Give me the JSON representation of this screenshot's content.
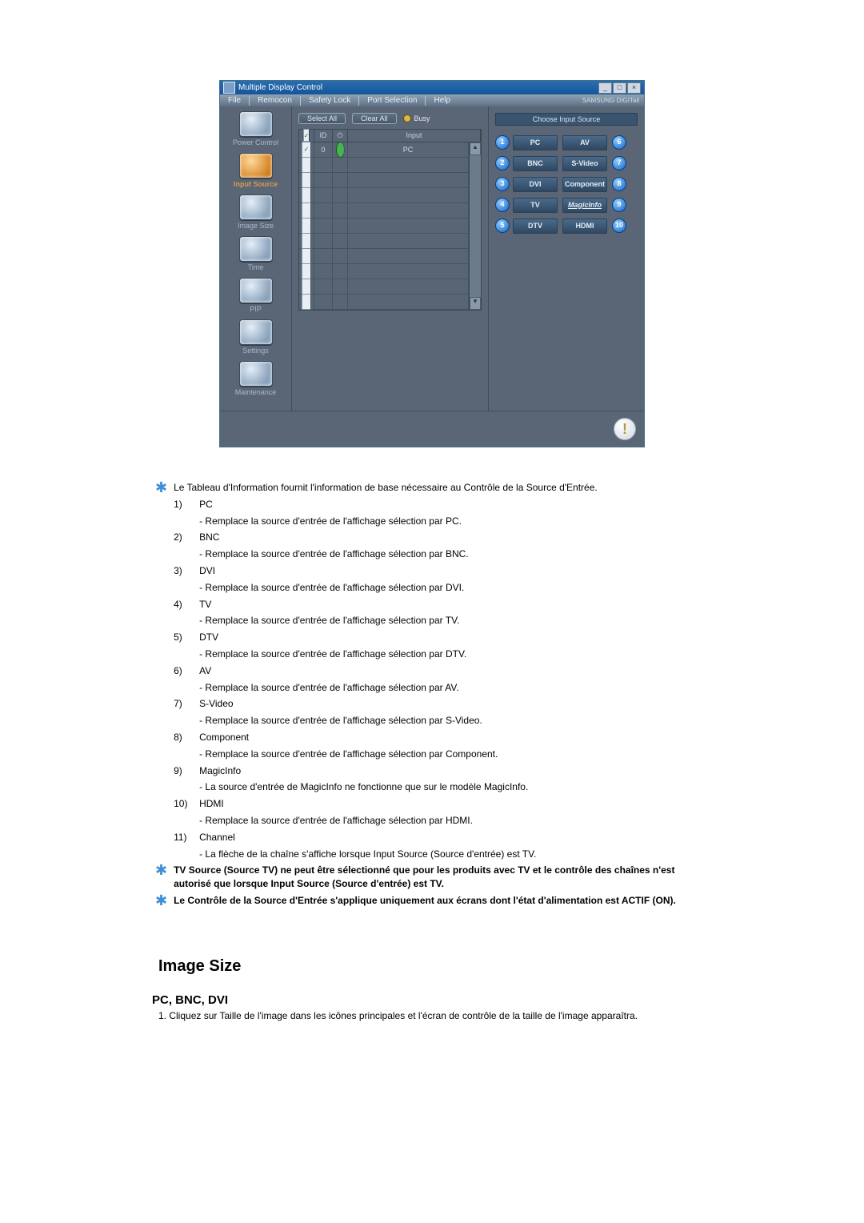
{
  "win": {
    "title": "Multiple Display Control",
    "menu": [
      "File",
      "Remocon",
      "Safety Lock",
      "Port Selection",
      "Help"
    ],
    "brand": "SAMSUNG DIGITall"
  },
  "nav": [
    {
      "label": "Power Control"
    },
    {
      "label": "Input Source"
    },
    {
      "label": "Image Size"
    },
    {
      "label": "Time"
    },
    {
      "label": "PIP"
    },
    {
      "label": "Settings"
    },
    {
      "label": "Maintenance"
    }
  ],
  "toolbar": {
    "selectAll": "Select All",
    "clearAll": "Clear All",
    "busy": "Busy"
  },
  "gridheader": {
    "id": "ID",
    "input": "Input"
  },
  "row0": {
    "id": "0",
    "input": "PC"
  },
  "right": {
    "title": "Choose Input Source",
    "left": [
      {
        "n": "1",
        "t": "PC"
      },
      {
        "n": "2",
        "t": "BNC"
      },
      {
        "n": "3",
        "t": "DVI"
      },
      {
        "n": "4",
        "t": "TV"
      },
      {
        "n": "5",
        "t": "DTV"
      }
    ],
    "rightcol": [
      {
        "n": "6",
        "t": "AV"
      },
      {
        "n": "7",
        "t": "S-Video"
      },
      {
        "n": "8",
        "t": "Component"
      },
      {
        "n": "9",
        "t": "MagicInfo"
      },
      {
        "n": "10",
        "t": "HDMI"
      }
    ]
  },
  "doc": {
    "intro": "Le Tableau d'Information fournit l'information de base nécessaire au Contrôle de la Source d'Entrée.",
    "items": [
      {
        "k": "1)",
        "t": "PC",
        "d": "- Remplace la source d'entrée de l'affichage sélection par PC."
      },
      {
        "k": "2)",
        "t": "BNC",
        "d": "- Remplace la source d'entrée de l'affichage sélection par BNC."
      },
      {
        "k": "3)",
        "t": "DVI",
        "d": "- Remplace la source d'entrée de l'affichage sélection par DVI."
      },
      {
        "k": "4)",
        "t": "TV",
        "d": "- Remplace la source d'entrée de l'affichage sélection par TV."
      },
      {
        "k": "5)",
        "t": "DTV",
        "d": "- Remplace la source d'entrée de l'affichage sélection par DTV."
      },
      {
        "k": "6)",
        "t": "AV",
        "d": "- Remplace la source d'entrée de l'affichage sélection par AV."
      },
      {
        "k": "7)",
        "t": "S-Video",
        "d": "- Remplace la source d'entrée de l'affichage sélection par S-Video."
      },
      {
        "k": "8)",
        "t": "Component",
        "d": "- Remplace la source d'entrée de l'affichage sélection par Component."
      },
      {
        "k": "9)",
        "t": "MagicInfo",
        "d": "- La source d'entrée de MagicInfo ne fonctionne que sur le modèle MagicInfo."
      },
      {
        "k": "10)",
        "t": "HDMI",
        "d": "- Remplace la source d'entrée de l'affichage sélection par HDMI."
      },
      {
        "k": "11)",
        "t": "Channel",
        "d": "- La flèche de la chaîne s'affiche lorsque Input Source (Source d'entrée) est TV."
      }
    ],
    "note1": "TV Source (Source TV) ne peut être sélectionné que pour les produits avec TV et le contrôle des chaînes n'est autorisé que lorsque Input Source (Source d'entrée) est TV.",
    "note2": "Le Contrôle de la Source d'Entrée s'applique uniquement aux écrans dont l'état d'alimentation est ACTIF (ON).",
    "h2": "Image Size",
    "h3": "PC, BNC, DVI",
    "step1": "1. Cliquez sur Taille de l'image dans les icônes principales et l'écran de contrôle de la taille de l'image apparaîtra."
  }
}
